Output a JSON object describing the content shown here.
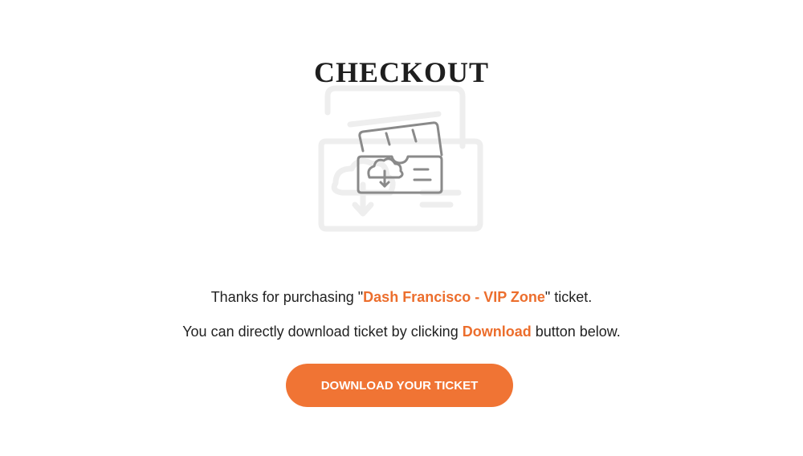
{
  "page": {
    "title": "CHECKOUT"
  },
  "illustration": {
    "icon": "ticket-cloud-download-icon"
  },
  "message": {
    "thanks_prefix": "Thanks for purchasing \"",
    "ticket_name": "Dash Francisco - VIP Zone",
    "thanks_suffix": "\" ticket.",
    "download_prefix": "You can directly download ticket by clicking ",
    "download_word": "Download",
    "download_suffix": " button below."
  },
  "button": {
    "label": "DOWNLOAD YOUR TICKET"
  },
  "colors": {
    "accent": "#ec6e2d",
    "button_bg": "#f07434",
    "text": "#222222",
    "icon_stroke": "#8a8a8a",
    "icon_faint": "#eeeeee"
  }
}
